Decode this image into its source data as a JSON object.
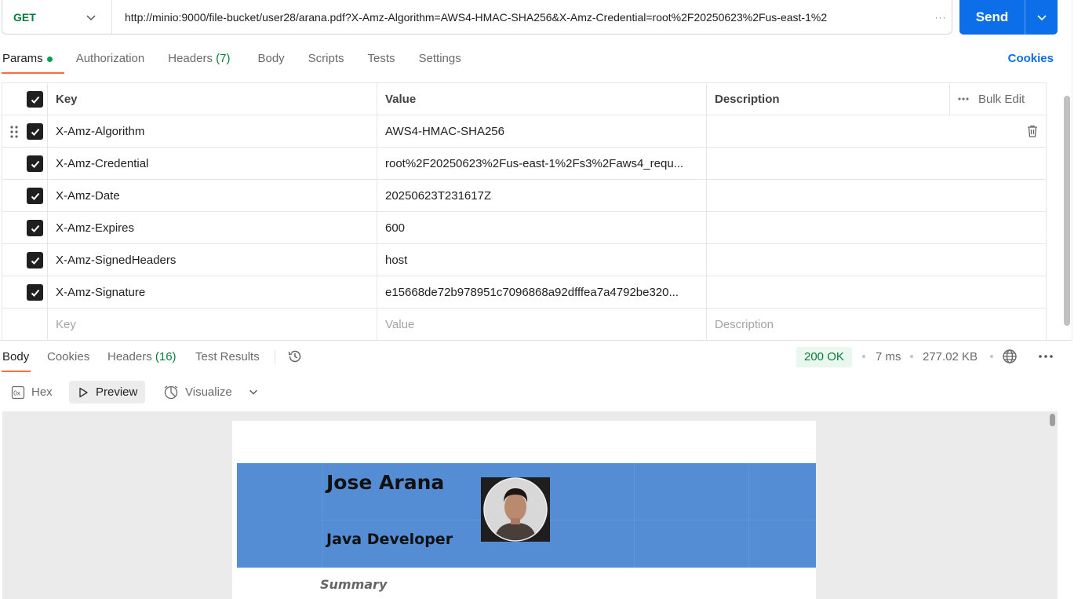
{
  "request": {
    "method": "GET",
    "url": "http://minio:9000/file-bucket/user28/arana.pdf?X-Amz-Algorithm=AWS4-HMAC-SHA256&X-Amz-Credential=root%2F20250623%2Fus-east-1%2",
    "url_overflow": "···",
    "send_label": "Send"
  },
  "request_tabs": {
    "params": "Params",
    "authorization": "Authorization",
    "headers": "Headers",
    "headers_count": "(7)",
    "body": "Body",
    "scripts": "Scripts",
    "tests": "Tests",
    "settings": "Settings",
    "cookies": "Cookies"
  },
  "params_table": {
    "headers": {
      "key": "Key",
      "value": "Value",
      "description": "Description",
      "bulk_edit": "Bulk Edit"
    },
    "rows": [
      {
        "key": "X-Amz-Algorithm",
        "value": "AWS4-HMAC-SHA256",
        "description": ""
      },
      {
        "key": "X-Amz-Credential",
        "value": "root%2F20250623%2Fus-east-1%2Fs3%2Faws4_requ...",
        "description": ""
      },
      {
        "key": "X-Amz-Date",
        "value": "20250623T231617Z",
        "description": ""
      },
      {
        "key": "X-Amz-Expires",
        "value": "600",
        "description": ""
      },
      {
        "key": "X-Amz-SignedHeaders",
        "value": "host",
        "description": ""
      },
      {
        "key": "X-Amz-Signature",
        "value": "e15668de72b978951c7096868a92dfffea7a4792be320...",
        "description": ""
      }
    ],
    "placeholders": {
      "key": "Key",
      "value": "Value",
      "description": "Description"
    }
  },
  "response": {
    "tabs": {
      "body": "Body",
      "cookies": "Cookies",
      "headers": "Headers",
      "headers_count": "(16)",
      "test_results": "Test Results"
    },
    "status": "200 OK",
    "time": "7 ms",
    "size": "277.02 KB",
    "view_options": {
      "hex": "Hex",
      "preview": "Preview",
      "visualize": "Visualize"
    }
  },
  "pdf_preview": {
    "name": "Jose Arana",
    "role": "Java Developer",
    "section": "Summary"
  },
  "colors": {
    "accent": "#0c6ee8",
    "tab_underline": "#ff6c37",
    "method_green": "#0a7d3e",
    "banner": "#548dd4"
  },
  "icons": [
    "chevron-down-icon",
    "drag-handle-icon",
    "checkbox-checked-icon",
    "trash-icon",
    "more-horizontal-icon",
    "history-icon",
    "globe-icon",
    "hex-icon",
    "play-icon",
    "visualize-icon"
  ]
}
